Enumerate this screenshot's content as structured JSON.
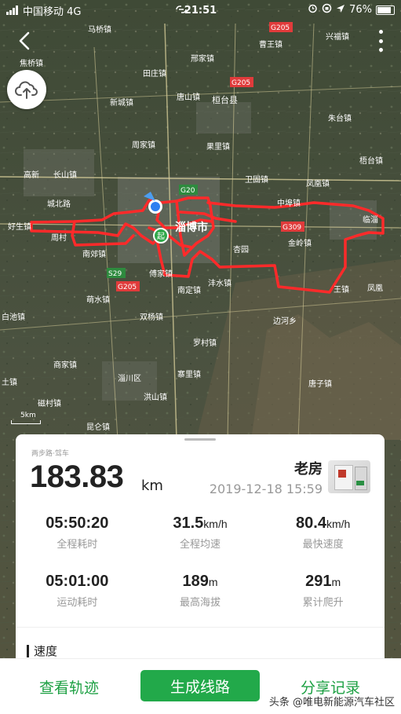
{
  "status_bar": {
    "carrier": "中国移动 4G",
    "time": "21:51",
    "battery": "76%",
    "icons": [
      "signal-icon",
      "link-icon",
      "alarm-icon",
      "lock-rotation-icon",
      "location-icon",
      "battery-icon"
    ]
  },
  "map": {
    "labels": [
      {
        "text": "马桥镇"
      },
      {
        "text": "曹王镇"
      },
      {
        "text": "兴福镇"
      },
      {
        "text": "焦桥镇"
      },
      {
        "text": "邢家镇"
      },
      {
        "text": "G205"
      },
      {
        "text": "田庄镇"
      },
      {
        "text": "G205"
      },
      {
        "text": "新城镇"
      },
      {
        "text": "唐山镇"
      },
      {
        "text": "桓台县"
      },
      {
        "text": "朱台镇"
      },
      {
        "text": "周家镇"
      },
      {
        "text": "果里镇"
      },
      {
        "text": "梧台镇"
      },
      {
        "text": "高新"
      },
      {
        "text": "长山镇"
      },
      {
        "text": "卫固镇"
      },
      {
        "text": "凤凰镇"
      },
      {
        "text": "G20"
      },
      {
        "text": "城北路"
      },
      {
        "text": "中埠镇"
      },
      {
        "text": "好生镇"
      },
      {
        "text": "G309"
      },
      {
        "text": "临淄"
      },
      {
        "text": "周村"
      },
      {
        "text": "淄博市"
      },
      {
        "text": "金岭镇"
      },
      {
        "text": "南郊镇"
      },
      {
        "text": "杏园"
      },
      {
        "text": "S29"
      },
      {
        "text": "G205"
      },
      {
        "text": "傅家镇"
      },
      {
        "text": "沣水镇"
      },
      {
        "text": "凤凰"
      },
      {
        "text": "萌水镇"
      },
      {
        "text": "南定镇"
      },
      {
        "text": "王镇"
      },
      {
        "text": "双杨镇"
      },
      {
        "text": "边河乡"
      },
      {
        "text": "白池镇"
      },
      {
        "text": "罗村镇"
      },
      {
        "text": "商家镇"
      },
      {
        "text": "淄川区"
      },
      {
        "text": "寨里镇"
      },
      {
        "text": "土镇"
      },
      {
        "text": "洪山镇"
      },
      {
        "text": "唐子镇"
      },
      {
        "text": "磁村镇"
      },
      {
        "text": "昆仑镇"
      }
    ],
    "start_marker": "起",
    "scale": "5km"
  },
  "card": {
    "source": "两步路·驾车",
    "distance": "183.83",
    "distance_unit": "km",
    "name": "老房",
    "datetime": "2019-12-18 15:59",
    "stats": [
      {
        "value": "05:50:20",
        "unit": "",
        "label": "全程耗时"
      },
      {
        "value": "31.5",
        "unit": "km/h",
        "label": "全程均速"
      },
      {
        "value": "80.4",
        "unit": "km/h",
        "label": "最快速度"
      },
      {
        "value": "05:01:00",
        "unit": "",
        "label": "运动耗时"
      },
      {
        "value": "189",
        "unit": "m",
        "label": "最高海拔"
      },
      {
        "value": "291",
        "unit": "m",
        "label": "累计爬升"
      }
    ],
    "section_title": "速度"
  },
  "bottom_bar": {
    "view_track": "查看轨迹",
    "generate_route": "生成线路",
    "share_record": "分享记录",
    "watermark": "头条 @唯电新能源汽车社区"
  },
  "colors": {
    "accent": "#22a94a",
    "route": "#ff2a2a",
    "road_label_bg": "#e03b3b"
  }
}
